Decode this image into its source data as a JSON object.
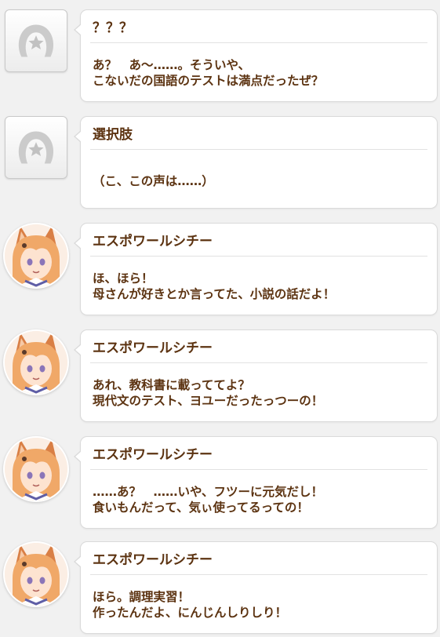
{
  "messages": [
    {
      "speaker": "？？？",
      "avatar": "placeholder-icon",
      "lines": [
        "あ？　あ～……。そういや、",
        "こないだの国語のテストは満点だったぜ？"
      ]
    },
    {
      "speaker": "選択肢",
      "avatar": "placeholder-icon",
      "lines": [
        "（こ、この声は……）"
      ]
    },
    {
      "speaker": "エスポワールシチー",
      "avatar": "character-portrait",
      "lines": [
        "ほ、ほら！",
        "母さんが好きとか言ってた、小説の話だよ！"
      ]
    },
    {
      "speaker": "エスポワールシチー",
      "avatar": "character-portrait",
      "lines": [
        "あれ、教科書に載っててよ？",
        "現代文のテスト、ヨユーだったっつーの！"
      ]
    },
    {
      "speaker": "エスポワールシチー",
      "avatar": "character-portrait",
      "lines": [
        "……あ？　……いや、フツーに元気だし！",
        "食いもんだって、気ぃ使ってるっての！"
      ]
    },
    {
      "speaker": "エスポワールシチー",
      "avatar": "character-portrait",
      "lines": [
        "ほら。調理実習！",
        "作ったんだよ、にんじんしりしり！"
      ]
    }
  ],
  "colors": {
    "text": "#5c3311",
    "bubble": "#ffffff",
    "background": "#f1f1f1",
    "hair": "#f0a868",
    "ear": "#d97f45"
  }
}
